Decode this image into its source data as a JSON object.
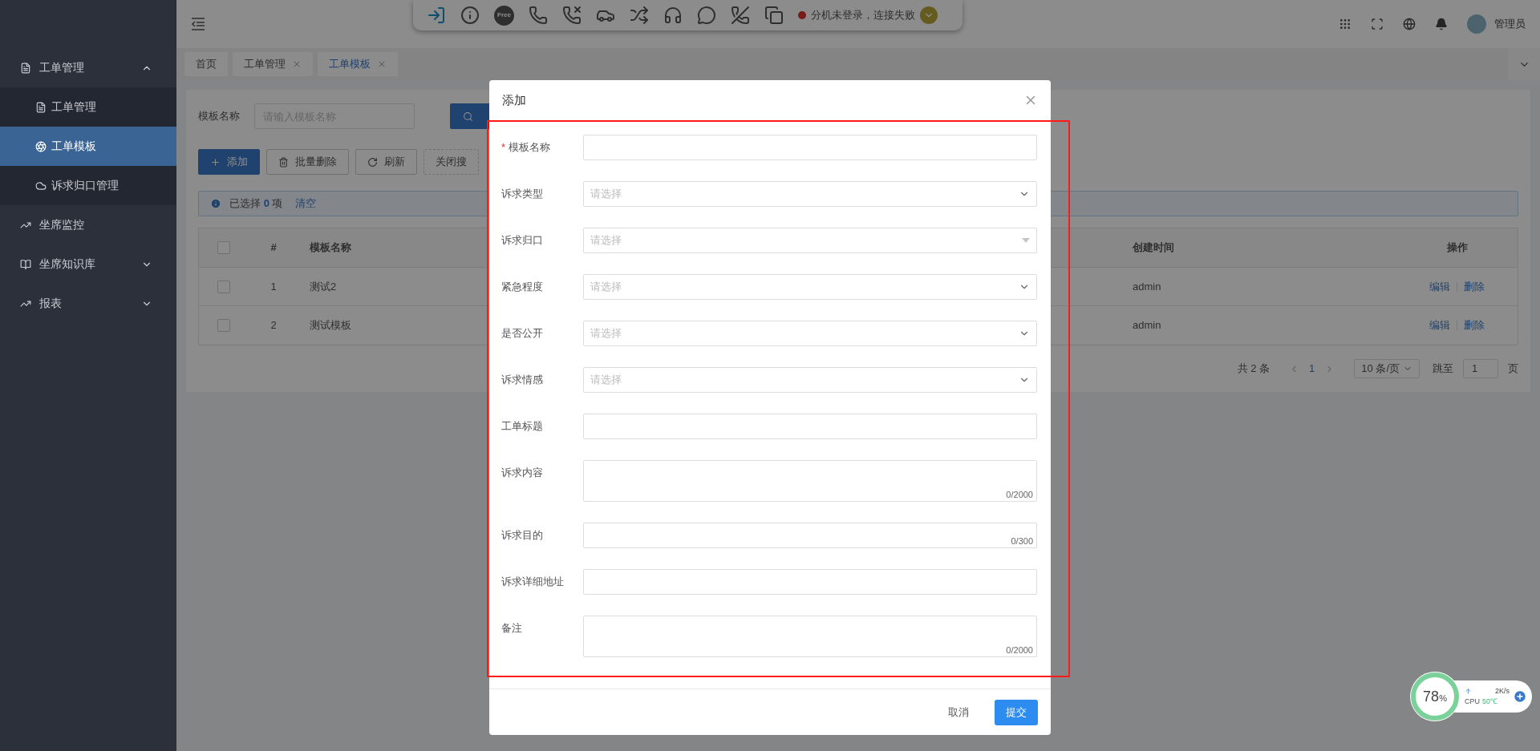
{
  "toolbar": {
    "free_label": "Free",
    "status_text": "分机未登录，连接失败"
  },
  "header": {
    "user_name": "管理员"
  },
  "sidebar": {
    "items": [
      {
        "label": "工单管理",
        "kind": "doc",
        "expanded": true,
        "selected": false,
        "children": [
          {
            "label": "工单管理",
            "kind": "doc",
            "selected": false
          },
          {
            "label": "工单模板",
            "kind": "aperture",
            "selected": true
          },
          {
            "label": "诉求归口管理",
            "kind": "cloud",
            "selected": false
          }
        ]
      },
      {
        "label": "坐席监控",
        "kind": "chart",
        "selected": false
      },
      {
        "label": "坐席知识库",
        "kind": "book",
        "expanded": false,
        "selected": false
      },
      {
        "label": "报表",
        "kind": "chart",
        "expanded": false,
        "selected": false
      }
    ]
  },
  "tabs": [
    {
      "label": "首页",
      "selected": false,
      "closable": false
    },
    {
      "label": "工单管理",
      "selected": false,
      "closable": true
    },
    {
      "label": "工单模板",
      "selected": true,
      "closable": true
    }
  ],
  "filter": {
    "label": "模板名称",
    "placeholder": "请输入模板名称"
  },
  "actions": [
    {
      "label": "添加",
      "kind": "primary"
    },
    {
      "label": "批量删除",
      "kind": "delete"
    },
    {
      "label": "刷新",
      "kind": "refresh"
    },
    {
      "label": "关闭搜",
      "kind": "dashed"
    }
  ],
  "selection_alert": {
    "text": "已选择 **0** 项",
    "clear_link": "清空"
  },
  "table": {
    "header_checked": false,
    "columns": [
      "#",
      "模板名称",
      "创建时间",
      "操作"
    ],
    "rows": [
      {
        "checked": false,
        "cells": [
          "1",
          "测试2",
          "admin"
        ],
        "actions": [
          "编辑",
          "删除"
        ]
      },
      {
        "checked": false,
        "cells": [
          "2",
          "测试模板",
          "admin"
        ],
        "actions": [
          "编辑",
          "删除"
        ]
      }
    ]
  },
  "pagination": {
    "total": "共 2 条",
    "pages": [
      {
        "label": "1",
        "selected": true
      }
    ],
    "page_size": "10 条/页",
    "jump_label": "跳至",
    "jump_value": "1",
    "page_unit": "页"
  },
  "modal": {
    "title": "添加",
    "fields": [
      {
        "label": "模板名称",
        "kind": "input",
        "required_mark": "*"
      },
      {
        "label": "诉求类型",
        "kind": "select",
        "placeholder": "请选择"
      },
      {
        "label": "诉求归口",
        "kind": "cascader",
        "placeholder": "请选择"
      },
      {
        "label": "紧急程度",
        "kind": "select",
        "placeholder": "请选择"
      },
      {
        "label": "是否公开",
        "kind": "select",
        "placeholder": "请选择"
      },
      {
        "label": "诉求情感",
        "kind": "select",
        "placeholder": "请选择"
      },
      {
        "label": "工单标题",
        "kind": "input"
      },
      {
        "label": "诉求内容",
        "kind": "textarea",
        "counter": "0/2000"
      },
      {
        "label": "诉求目的",
        "kind": "textarea_short",
        "counter": "0/300"
      },
      {
        "label": "诉求详细地址",
        "kind": "input"
      },
      {
        "label": "备注",
        "kind": "textarea",
        "counter": "0/2000"
      }
    ],
    "cancel": "取消",
    "submit": "提交"
  },
  "monitor": {
    "percent": "78",
    "unit": "%",
    "speed": "2K/s",
    "cpu_label": "CPU",
    "temp": "50℃"
  }
}
